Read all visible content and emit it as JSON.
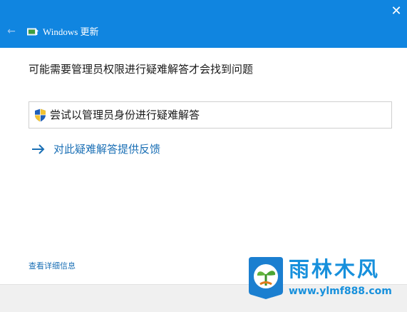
{
  "window": {
    "title": "Windows 更新",
    "close_symbol": "✕",
    "back_symbol": "←",
    "accent_color": "#1085e0"
  },
  "content": {
    "heading": "可能需要管理员权限进行疑难解答才会找到问题",
    "admin_button_label": "尝试以管理员身份进行疑难解答",
    "feedback_link_label": "对此疑难解答提供反馈",
    "details_link_label": "查看详细信息"
  },
  "watermark": {
    "brand": "雨林木风",
    "url": "www.ylmf888.com",
    "color": "#1790dc"
  },
  "icons": {
    "back": "back-arrow-icon",
    "app": "windows-update-icon",
    "close": "close-icon",
    "shield": "uac-shield-icon",
    "feedback": "right-arrow-icon",
    "logo": "ylmf-logo-icon"
  }
}
